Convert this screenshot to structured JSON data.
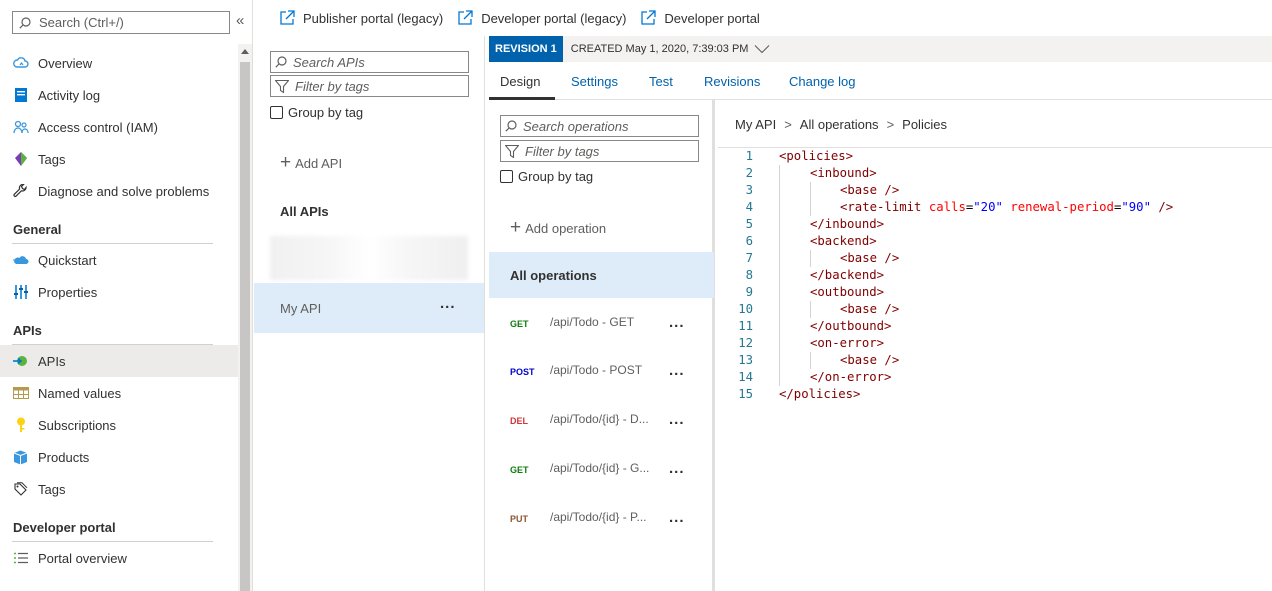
{
  "nav": {
    "search_placeholder": "Search (Ctrl+/)",
    "collapse_glyph": "«",
    "items_top": [
      {
        "label": "Overview",
        "icon": "cloud-icon"
      },
      {
        "label": "Activity log",
        "icon": "activity-log-icon"
      },
      {
        "label": "Access control (IAM)",
        "icon": "people-icon"
      },
      {
        "label": "Tags",
        "icon": "tag-icon"
      },
      {
        "label": "Diagnose and solve problems",
        "icon": "wrench-icon"
      }
    ],
    "section_general": "General",
    "items_general": [
      {
        "label": "Quickstart",
        "icon": "quickstart-icon"
      },
      {
        "label": "Properties",
        "icon": "properties-icon"
      }
    ],
    "section_apis": "APIs",
    "items_apis": [
      {
        "label": "APIs",
        "icon": "api-icon"
      },
      {
        "label": "Named values",
        "icon": "table-icon"
      },
      {
        "label": "Subscriptions",
        "icon": "key-icon"
      },
      {
        "label": "Products",
        "icon": "products-icon"
      },
      {
        "label": "Tags",
        "icon": "tags-outline-icon"
      }
    ],
    "section_dev": "Developer portal",
    "items_dev": [
      {
        "label": "Portal overview",
        "icon": "list-icon"
      }
    ]
  },
  "toolbar": {
    "publisher_portal": "Publisher portal (legacy)",
    "developer_portal_legacy": "Developer portal (legacy)",
    "developer_portal": "Developer portal"
  },
  "apis_panel": {
    "search_placeholder": "Search APIs",
    "filter_placeholder": "Filter by tags",
    "group_by_tag": "Group by tag",
    "add_api": "Add API",
    "all_apis": "All APIs",
    "selected_api": "My API",
    "more": "..."
  },
  "revision": {
    "badge": "REVISION 1",
    "created": "CREATED May 1, 2020, 7:39:03 PM"
  },
  "tabs": [
    "Design",
    "Settings",
    "Test",
    "Revisions",
    "Change log"
  ],
  "ops_panel": {
    "search_placeholder": "Search operations",
    "filter_placeholder": "Filter by tags",
    "group_by_tag": "Group by tag",
    "add_operation": "Add operation",
    "all_operations": "All operations",
    "more": "...",
    "operations": [
      {
        "verb": "GET",
        "path": "/api/Todo - GET",
        "color": "#107c10"
      },
      {
        "verb": "POST",
        "path": "/api/Todo - POST",
        "color": "#0000cc"
      },
      {
        "verb": "DEL",
        "path": "/api/Todo/{id} - D...",
        "color": "#d13438"
      },
      {
        "verb": "GET",
        "path": "/api/Todo/{id} - G...",
        "color": "#107c10"
      },
      {
        "verb": "PUT",
        "path": "/api/Todo/{id} - P...",
        "color": "#8e562e"
      }
    ]
  },
  "breadcrumb": [
    "My API",
    "All operations",
    "Policies"
  ],
  "breadcrumb_sep": ">",
  "code": {
    "line_numbers": [
      "1",
      "2",
      "3",
      "4",
      "5",
      "6",
      "7",
      "8",
      "9",
      "10",
      "11",
      "12",
      "13",
      "14",
      "15"
    ],
    "lines": [
      "<policies>",
      "<inbound>",
      "<base />",
      "<rate-limit calls=\"20\" renewal-period=\"90\" />",
      "</inbound>",
      "<backend>",
      "<base />",
      "</backend>",
      "<outbound>",
      "<base />",
      "</outbound>",
      "<on-error>",
      "<base />",
      "</on-error>",
      "</policies>"
    ],
    "indent": [
      0,
      1,
      2,
      2,
      1,
      1,
      2,
      1,
      1,
      2,
      1,
      1,
      2,
      1,
      0
    ],
    "rate_limit_tokens": {
      "open": "<rate-limit ",
      "attr1": "calls",
      "eq": "=",
      "val1": "\"20\"",
      "attr2": "renewal-period",
      "val2": "\"90\"",
      "close": " />"
    }
  },
  "colors": {
    "accent": "#0062ad",
    "selected_bg": "#deecf9",
    "nav_active_bg": "#edebe9"
  }
}
